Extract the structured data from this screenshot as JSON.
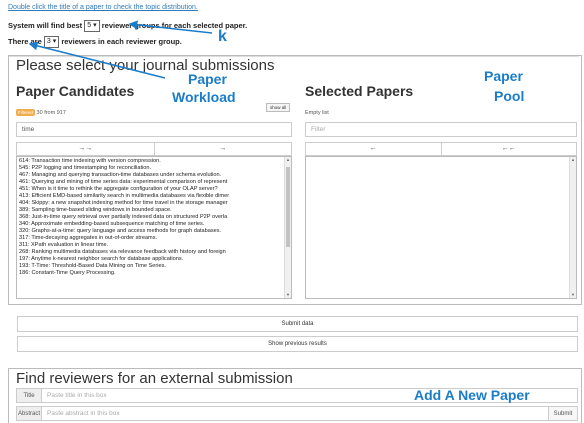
{
  "instructions": {
    "double_click_hint": "Double click the title of a paper to check the topic distribution.",
    "groups_line_before": "System will find best",
    "groups_value": "5",
    "groups_line_after": "reviewer groups for each selected paper.",
    "reviewers_line_before": "There are",
    "reviewers_value": "3",
    "reviewers_line_after": "reviewers in each reviewer group."
  },
  "main_panel": {
    "title": "Please select your journal submissions"
  },
  "candidates": {
    "title": "Paper Candidates",
    "show_all_label": "show all",
    "filter_badge": "Filtered",
    "count_text": "30 from 917",
    "filter_value": "time",
    "move_all_icon": "→→",
    "move_selected_icon": "→",
    "items": [
      "614: Transaction time indexing with version compression.",
      "545: P2P logging and timestamping for reconciliation.",
      "467: Managing and querying transaction-time databases under schema evolution.",
      "461: Querying and mining of time series data: experimental comparison of represent",
      "451: When is it time to rethink the aggregate configuration of your OLAP server?",
      "413: Efficient EMD-based similarity search in multimedia databases via flexible dimer",
      "404: Skippy: a new snapshot indexing method for time travel in the storage manager",
      "389: Sampling time-based sliding windows in bounded space.",
      "368: Just-in-time query retrieval over partially indexed data on structured P2P overla",
      "340: Approximate embedding-based subsequence matching of time series.",
      "320: Graphs-at-a-time: query language and access methods for graph databases.",
      "317: Time-decaying aggregates in out-of-order streams.",
      "311: XPath evaluation in linear time.",
      "268: Ranking multimedia databases via relevance feedback with history and foreign",
      "197: Anytime k-nearest neighbor search for database applications.",
      "193: T-Time: Threshold-Based Data Mining on Time Series.",
      "186: Constant-Time Query Processing."
    ]
  },
  "selected": {
    "title": "Selected Papers",
    "empty_text": "Empty list",
    "filter_placeholder": "Filter",
    "remove_selected_icon": "←",
    "remove_all_icon": "←←"
  },
  "actions": {
    "submit_label": "Submit data",
    "previous_label": "Show previous results"
  },
  "external": {
    "title": "Find reviewers for an external submission",
    "title_label": "Title",
    "title_placeholder": "Paste title in this box",
    "abstract_label": "Abstract",
    "abstract_placeholder": "Paste abstract in this box",
    "submit_label": "Submit"
  },
  "annotations": {
    "k": "k",
    "paper_workload_1": "Paper",
    "paper_workload_2": "Workload",
    "paper_pool_1": "Paper",
    "paper_pool_2": "Pool",
    "add_paper": "Add A New Paper",
    "color": "#1b7cc9"
  }
}
